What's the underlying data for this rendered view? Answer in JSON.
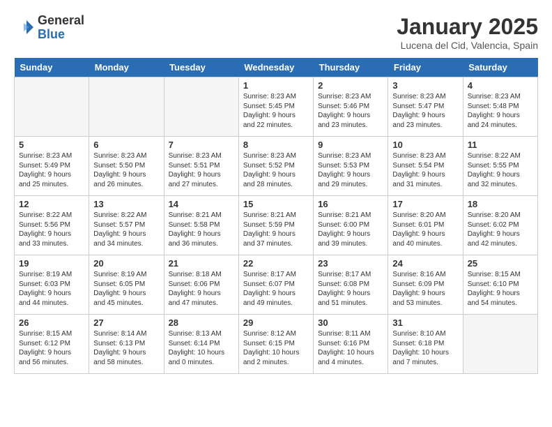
{
  "header": {
    "logo_general": "General",
    "logo_blue": "Blue",
    "month_title": "January 2025",
    "location": "Lucena del Cid, Valencia, Spain"
  },
  "days_of_week": [
    "Sunday",
    "Monday",
    "Tuesday",
    "Wednesday",
    "Thursday",
    "Friday",
    "Saturday"
  ],
  "weeks": [
    [
      {
        "day": "",
        "info": ""
      },
      {
        "day": "",
        "info": ""
      },
      {
        "day": "",
        "info": ""
      },
      {
        "day": "1",
        "info": "Sunrise: 8:23 AM\nSunset: 5:45 PM\nDaylight: 9 hours\nand 22 minutes."
      },
      {
        "day": "2",
        "info": "Sunrise: 8:23 AM\nSunset: 5:46 PM\nDaylight: 9 hours\nand 23 minutes."
      },
      {
        "day": "3",
        "info": "Sunrise: 8:23 AM\nSunset: 5:47 PM\nDaylight: 9 hours\nand 23 minutes."
      },
      {
        "day": "4",
        "info": "Sunrise: 8:23 AM\nSunset: 5:48 PM\nDaylight: 9 hours\nand 24 minutes."
      }
    ],
    [
      {
        "day": "5",
        "info": "Sunrise: 8:23 AM\nSunset: 5:49 PM\nDaylight: 9 hours\nand 25 minutes."
      },
      {
        "day": "6",
        "info": "Sunrise: 8:23 AM\nSunset: 5:50 PM\nDaylight: 9 hours\nand 26 minutes."
      },
      {
        "day": "7",
        "info": "Sunrise: 8:23 AM\nSunset: 5:51 PM\nDaylight: 9 hours\nand 27 minutes."
      },
      {
        "day": "8",
        "info": "Sunrise: 8:23 AM\nSunset: 5:52 PM\nDaylight: 9 hours\nand 28 minutes."
      },
      {
        "day": "9",
        "info": "Sunrise: 8:23 AM\nSunset: 5:53 PM\nDaylight: 9 hours\nand 29 minutes."
      },
      {
        "day": "10",
        "info": "Sunrise: 8:23 AM\nSunset: 5:54 PM\nDaylight: 9 hours\nand 31 minutes."
      },
      {
        "day": "11",
        "info": "Sunrise: 8:22 AM\nSunset: 5:55 PM\nDaylight: 9 hours\nand 32 minutes."
      }
    ],
    [
      {
        "day": "12",
        "info": "Sunrise: 8:22 AM\nSunset: 5:56 PM\nDaylight: 9 hours\nand 33 minutes."
      },
      {
        "day": "13",
        "info": "Sunrise: 8:22 AM\nSunset: 5:57 PM\nDaylight: 9 hours\nand 34 minutes."
      },
      {
        "day": "14",
        "info": "Sunrise: 8:21 AM\nSunset: 5:58 PM\nDaylight: 9 hours\nand 36 minutes."
      },
      {
        "day": "15",
        "info": "Sunrise: 8:21 AM\nSunset: 5:59 PM\nDaylight: 9 hours\nand 37 minutes."
      },
      {
        "day": "16",
        "info": "Sunrise: 8:21 AM\nSunset: 6:00 PM\nDaylight: 9 hours\nand 39 minutes."
      },
      {
        "day": "17",
        "info": "Sunrise: 8:20 AM\nSunset: 6:01 PM\nDaylight: 9 hours\nand 40 minutes."
      },
      {
        "day": "18",
        "info": "Sunrise: 8:20 AM\nSunset: 6:02 PM\nDaylight: 9 hours\nand 42 minutes."
      }
    ],
    [
      {
        "day": "19",
        "info": "Sunrise: 8:19 AM\nSunset: 6:03 PM\nDaylight: 9 hours\nand 44 minutes."
      },
      {
        "day": "20",
        "info": "Sunrise: 8:19 AM\nSunset: 6:05 PM\nDaylight: 9 hours\nand 45 minutes."
      },
      {
        "day": "21",
        "info": "Sunrise: 8:18 AM\nSunset: 6:06 PM\nDaylight: 9 hours\nand 47 minutes."
      },
      {
        "day": "22",
        "info": "Sunrise: 8:17 AM\nSunset: 6:07 PM\nDaylight: 9 hours\nand 49 minutes."
      },
      {
        "day": "23",
        "info": "Sunrise: 8:17 AM\nSunset: 6:08 PM\nDaylight: 9 hours\nand 51 minutes."
      },
      {
        "day": "24",
        "info": "Sunrise: 8:16 AM\nSunset: 6:09 PM\nDaylight: 9 hours\nand 53 minutes."
      },
      {
        "day": "25",
        "info": "Sunrise: 8:15 AM\nSunset: 6:10 PM\nDaylight: 9 hours\nand 54 minutes."
      }
    ],
    [
      {
        "day": "26",
        "info": "Sunrise: 8:15 AM\nSunset: 6:12 PM\nDaylight: 9 hours\nand 56 minutes."
      },
      {
        "day": "27",
        "info": "Sunrise: 8:14 AM\nSunset: 6:13 PM\nDaylight: 9 hours\nand 58 minutes."
      },
      {
        "day": "28",
        "info": "Sunrise: 8:13 AM\nSunset: 6:14 PM\nDaylight: 10 hours\nand 0 minutes."
      },
      {
        "day": "29",
        "info": "Sunrise: 8:12 AM\nSunset: 6:15 PM\nDaylight: 10 hours\nand 2 minutes."
      },
      {
        "day": "30",
        "info": "Sunrise: 8:11 AM\nSunset: 6:16 PM\nDaylight: 10 hours\nand 4 minutes."
      },
      {
        "day": "31",
        "info": "Sunrise: 8:10 AM\nSunset: 6:18 PM\nDaylight: 10 hours\nand 7 minutes."
      },
      {
        "day": "",
        "info": ""
      }
    ]
  ]
}
